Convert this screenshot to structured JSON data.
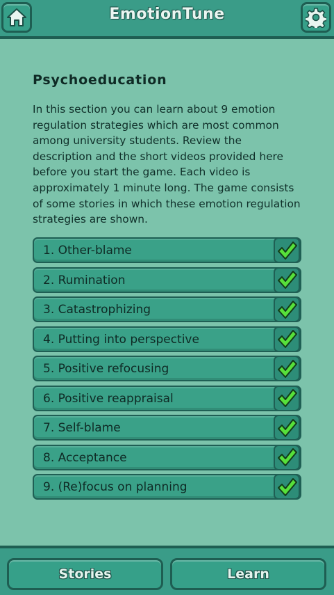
{
  "header": {
    "title": "EmotionTune",
    "home_icon": "home-icon",
    "settings_icon": "gear-icon"
  },
  "section": {
    "title": "Psychoeducation",
    "intro_lines": [
      "In this section you can learn about 9 emotion",
      "regulation strategies which are most common",
      "among university students. Review the",
      "description and the short videos provided here",
      "before you start the game. Each video is",
      "approximately 1 minute long. The game consists",
      "of some stories in which these emotion regulation",
      "strategies are shown."
    ]
  },
  "strategies": [
    {
      "label": "1. Other-blame",
      "completed": true
    },
    {
      "label": "2. Rumination",
      "completed": true
    },
    {
      "label": "3. Catastrophizing",
      "completed": true
    },
    {
      "label": "4. Putting into perspective",
      "completed": true
    },
    {
      "label": "5. Positive refocusing",
      "completed": true
    },
    {
      "label": "6. Positive reappraisal",
      "completed": true
    },
    {
      "label": "7. Self-blame",
      "completed": true
    },
    {
      "label": "8. Acceptance",
      "completed": true
    },
    {
      "label": "9. (Re)focus on planning",
      "completed": true
    }
  ],
  "footer": {
    "stories_label": "Stories",
    "learn_label": "Learn"
  },
  "colors": {
    "background": "#7cc3ab",
    "bar": "#3a9c88",
    "button": "#3aa188",
    "border": "#1f5f54",
    "check": "#57e03a"
  }
}
